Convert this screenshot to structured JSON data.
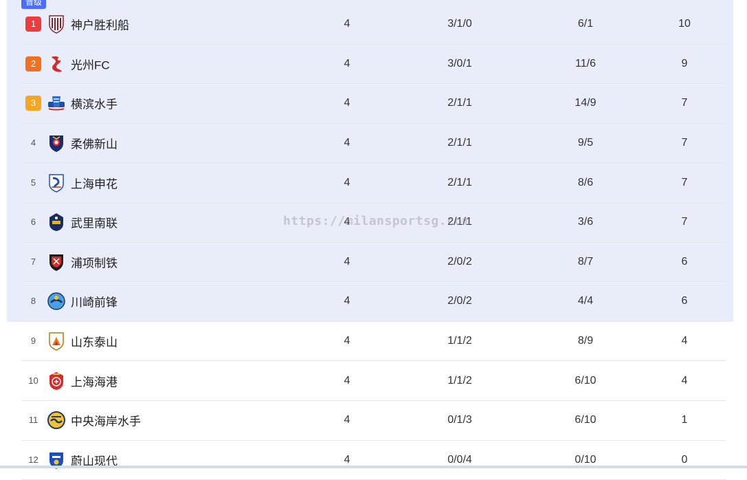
{
  "promo_tag": "晋级",
  "colors": {
    "promotion_bg": "#e9edfa",
    "tag_bg": "#4c6ef5",
    "rank_1": "#ee3b3b",
    "rank_2": "#f3701e",
    "rank_3": "#f6a623"
  },
  "watermark": "https://milansportsg.com",
  "rows": [
    {
      "rank": "1",
      "team": "神户胜利船",
      "played": "4",
      "wdl": "3/1/0",
      "goals": "6/1",
      "points": "10",
      "logo": "vissel-kobe-logo"
    },
    {
      "rank": "2",
      "team": "光州FC",
      "played": "4",
      "wdl": "3/0/1",
      "goals": "11/6",
      "points": "9",
      "logo": "gwangju-fc-logo"
    },
    {
      "rank": "3",
      "team": "横滨水手",
      "played": "4",
      "wdl": "2/1/1",
      "goals": "14/9",
      "points": "7",
      "logo": "yokohama-marinos-logo"
    },
    {
      "rank": "4",
      "team": "柔佛新山",
      "played": "4",
      "wdl": "2/1/1",
      "goals": "9/5",
      "points": "7",
      "logo": "johor-darul-tazim-logo"
    },
    {
      "rank": "5",
      "team": "上海申花",
      "played": "4",
      "wdl": "2/1/1",
      "goals": "8/6",
      "points": "7",
      "logo": "shanghai-shenhua-logo"
    },
    {
      "rank": "6",
      "team": "武里南联",
      "played": "4",
      "wdl": "2/1/1",
      "goals": "3/6",
      "points": "7",
      "logo": "buriram-united-logo"
    },
    {
      "rank": "7",
      "team": "浦项制铁",
      "played": "4",
      "wdl": "2/0/2",
      "goals": "8/7",
      "points": "6",
      "logo": "pohang-steelers-logo"
    },
    {
      "rank": "8",
      "team": "川崎前锋",
      "played": "4",
      "wdl": "2/0/2",
      "goals": "4/4",
      "points": "6",
      "logo": "kawasaki-frontale-logo"
    },
    {
      "rank": "9",
      "team": "山东泰山",
      "played": "4",
      "wdl": "1/1/2",
      "goals": "8/9",
      "points": "4",
      "logo": "shandong-taishan-logo"
    },
    {
      "rank": "10",
      "team": "上海海港",
      "played": "4",
      "wdl": "1/1/2",
      "goals": "6/10",
      "points": "4",
      "logo": "shanghai-port-logo"
    },
    {
      "rank": "11",
      "team": "中央海岸水手",
      "played": "4",
      "wdl": "0/1/3",
      "goals": "6/10",
      "points": "1",
      "logo": "central-coast-mariners-logo"
    },
    {
      "rank": "12",
      "team": "蔚山现代",
      "played": "4",
      "wdl": "0/0/4",
      "goals": "0/10",
      "points": "0",
      "logo": "ulsan-hyundai-logo"
    }
  ]
}
